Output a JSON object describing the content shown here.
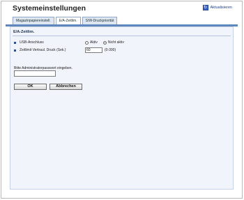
{
  "header": {
    "title": "Systemeinstellungen",
    "refresh_label": "Aktualisieren"
  },
  "tabs": [
    {
      "label": "Magazinpapiereinstell."
    },
    {
      "label": "E/A-Zeitlim."
    },
    {
      "label": "S/W-Druckpriorität"
    }
  ],
  "panel": {
    "section_title": "E/A-Zeitlim.",
    "usb": {
      "label": "USB-Anschluss",
      "options": [
        "Aktiv",
        "Nicht aktiv"
      ],
      "selected": "Nicht aktiv"
    },
    "timeout": {
      "label": "Zeitlimit Vertraul. Druck (Sek.)",
      "value": "60",
      "range": "(0-300)"
    },
    "password": {
      "label": "Bitte Administratorpasswort eingeben.",
      "value": ""
    },
    "buttons": {
      "ok": "OK",
      "cancel": "Abbrechen"
    }
  }
}
